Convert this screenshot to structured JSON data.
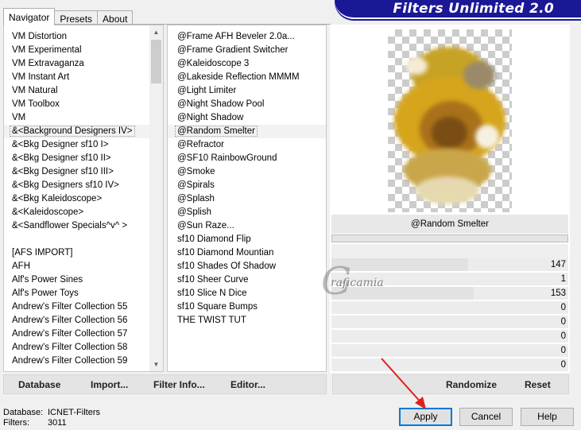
{
  "banner": {
    "title": "Filters Unlimited 2.0"
  },
  "tabs": [
    {
      "label": "Navigator",
      "active": true
    },
    {
      "label": "Presets",
      "active": false
    },
    {
      "label": "About",
      "active": false
    }
  ],
  "categories": [
    "VM Distortion",
    "VM Experimental",
    "VM Extravaganza",
    "VM Instant Art",
    "VM Natural",
    "VM Toolbox",
    "VM",
    "&<Background Designers IV>",
    "&<Bkg Designer sf10 I>",
    "&<Bkg Designer sf10 II>",
    "&<Bkg Designer sf10 III>",
    "&<Bkg Designers sf10 IV>",
    "&<Bkg Kaleidoscope>",
    "&<Kaleidoscope>",
    "&<Sandflower Specials^v^ >",
    "",
    "[AFS IMPORT]",
    "AFH",
    "Alf's Power Sines",
    "Alf's Power Toys",
    "Andrew's Filter Collection 55",
    "Andrew's Filter Collection 56",
    "Andrew's Filter Collection 57",
    "Andrew's Filter Collection 58",
    "Andrew's Filter Collection 59"
  ],
  "selected_category": "&<Background Designers IV>",
  "filters": [
    "@Frame AFH Beveler 2.0a...",
    "@Frame Gradient Switcher",
    "@Kaleidoscope 3",
    "@Lakeside Reflection MMMM",
    "@Light Limiter",
    "@Night Shadow Pool",
    "@Night Shadow",
    "@Random Smelter",
    "@Refractor",
    "@SF10 RainbowGround",
    "@Smoke",
    "@Spirals",
    "@Splash",
    "@Splish",
    "@Sun Raze...",
    "sf10 Diamond Flip",
    "sf10 Diamond Mountian",
    "sf10 Shades Of Shadow",
    "sf10 Sheer Curve",
    "sf10 Slice N Dice",
    "sf10 Square Bumps",
    "THE TWIST TUT"
  ],
  "selected_filter": "@Random Smelter",
  "preview": {
    "filter_name": "@Random Smelter"
  },
  "sliders": [
    {
      "value": "147",
      "fraction": 0.576
    },
    {
      "value": "1",
      "fraction": 0.004
    },
    {
      "value": "153",
      "fraction": 0.6
    },
    {
      "value": "0",
      "fraction": 0
    },
    {
      "value": "0",
      "fraction": 0
    },
    {
      "value": "0",
      "fraction": 0
    },
    {
      "value": "0",
      "fraction": 0
    },
    {
      "value": "0",
      "fraction": 0
    }
  ],
  "watermark": {
    "letter": "G",
    "text": "raficamia"
  },
  "toolbar_left": {
    "database": "Database",
    "import": "Import...",
    "filter_info": "Filter Info...",
    "editor": "Editor..."
  },
  "toolbar_right": {
    "randomize": "Randomize",
    "reset": "Reset"
  },
  "status": {
    "database_label": "Database:",
    "database_value": "ICNET-Filters",
    "filters_label": "Filters:",
    "filters_value": "3011"
  },
  "buttons": {
    "apply": "Apply",
    "cancel": "Cancel",
    "help": "Help"
  },
  "colors": {
    "banner": "#1b1896",
    "default_button_border": "#0078d7",
    "arrow": "#e0201c"
  }
}
